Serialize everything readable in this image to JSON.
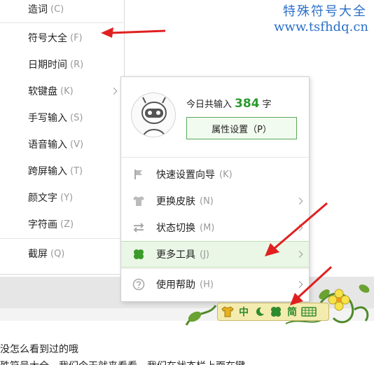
{
  "watermark": {
    "title": "特殊符号大全",
    "url": "www.tsfhdq.cn"
  },
  "left_menu": {
    "items": [
      {
        "label": "造词",
        "key": "(C)"
      },
      {
        "label": "符号大全",
        "key": "(F)"
      },
      {
        "label": "日期时间",
        "key": "(R)"
      },
      {
        "label": "软键盘",
        "key": "(K)"
      },
      {
        "label": "手写输入",
        "key": "(S)"
      },
      {
        "label": "语音输入",
        "key": "(V)"
      },
      {
        "label": "跨屏输入",
        "key": "(T)"
      },
      {
        "label": "颜文字",
        "key": "(Y)"
      },
      {
        "label": "字符画",
        "key": "(Z)"
      },
      {
        "label": "截屏",
        "key": "(Q)"
      }
    ]
  },
  "right_menu": {
    "stats_prefix": "今日共输入",
    "stats_count": "384",
    "stats_unit": "字",
    "property_button": "属性设置（P）",
    "items": [
      {
        "label": "快速设置向导",
        "key": "(K)"
      },
      {
        "label": "更换皮肤",
        "key": "(N)"
      },
      {
        "label": "状态切换",
        "key": "(M)"
      },
      {
        "label": "更多工具",
        "key": "(J)"
      },
      {
        "label": "使用帮助",
        "key": "(H)"
      }
    ]
  },
  "ime_toolbar": {
    "chinese_mode": "中",
    "simplified": "简"
  },
  "document": {
    "line1": "没怎么看到过的哦",
    "line2": "殊符号大全，我们今天就来看看，我们在状态栏上面在键"
  },
  "colors": {
    "accent_green": "#2e9a2e",
    "arrow_red": "#e02020",
    "watermark_blue": "#2a6fc8"
  }
}
